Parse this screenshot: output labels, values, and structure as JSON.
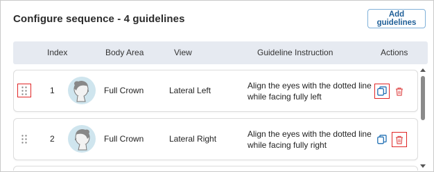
{
  "panel": {
    "title": "Configure sequence - 4 guidelines",
    "add_button_label": "Add guidelines"
  },
  "table": {
    "columns": [
      "Index",
      "Body Area",
      "View",
      "Guideline Instruction",
      "Actions"
    ],
    "rows": [
      {
        "index": "1",
        "body_area": "Full Crown",
        "view": "Lateral Left",
        "instruction": "Align the eyes with the dotted line while facing fully left",
        "avatar_icon": "head-profile-left-icon",
        "highlighted": "drag-handle, copy-action"
      },
      {
        "index": "2",
        "body_area": "Full Crown",
        "view": "Lateral Right",
        "instruction": "Align the eyes with the dotted line while facing fully right",
        "avatar_icon": "head-profile-right-icon",
        "highlighted": "delete-action"
      }
    ]
  },
  "icons": {
    "drag": "drag-handle-icon",
    "copy": "copy-icon",
    "delete": "trash-icon"
  },
  "colors": {
    "accent_blue": "#1f6fb3",
    "delete_red": "#e05050",
    "highlight_red": "#e02424",
    "header_bg": "#e6eaf1",
    "avatar_bg": "#cfe5ee"
  }
}
